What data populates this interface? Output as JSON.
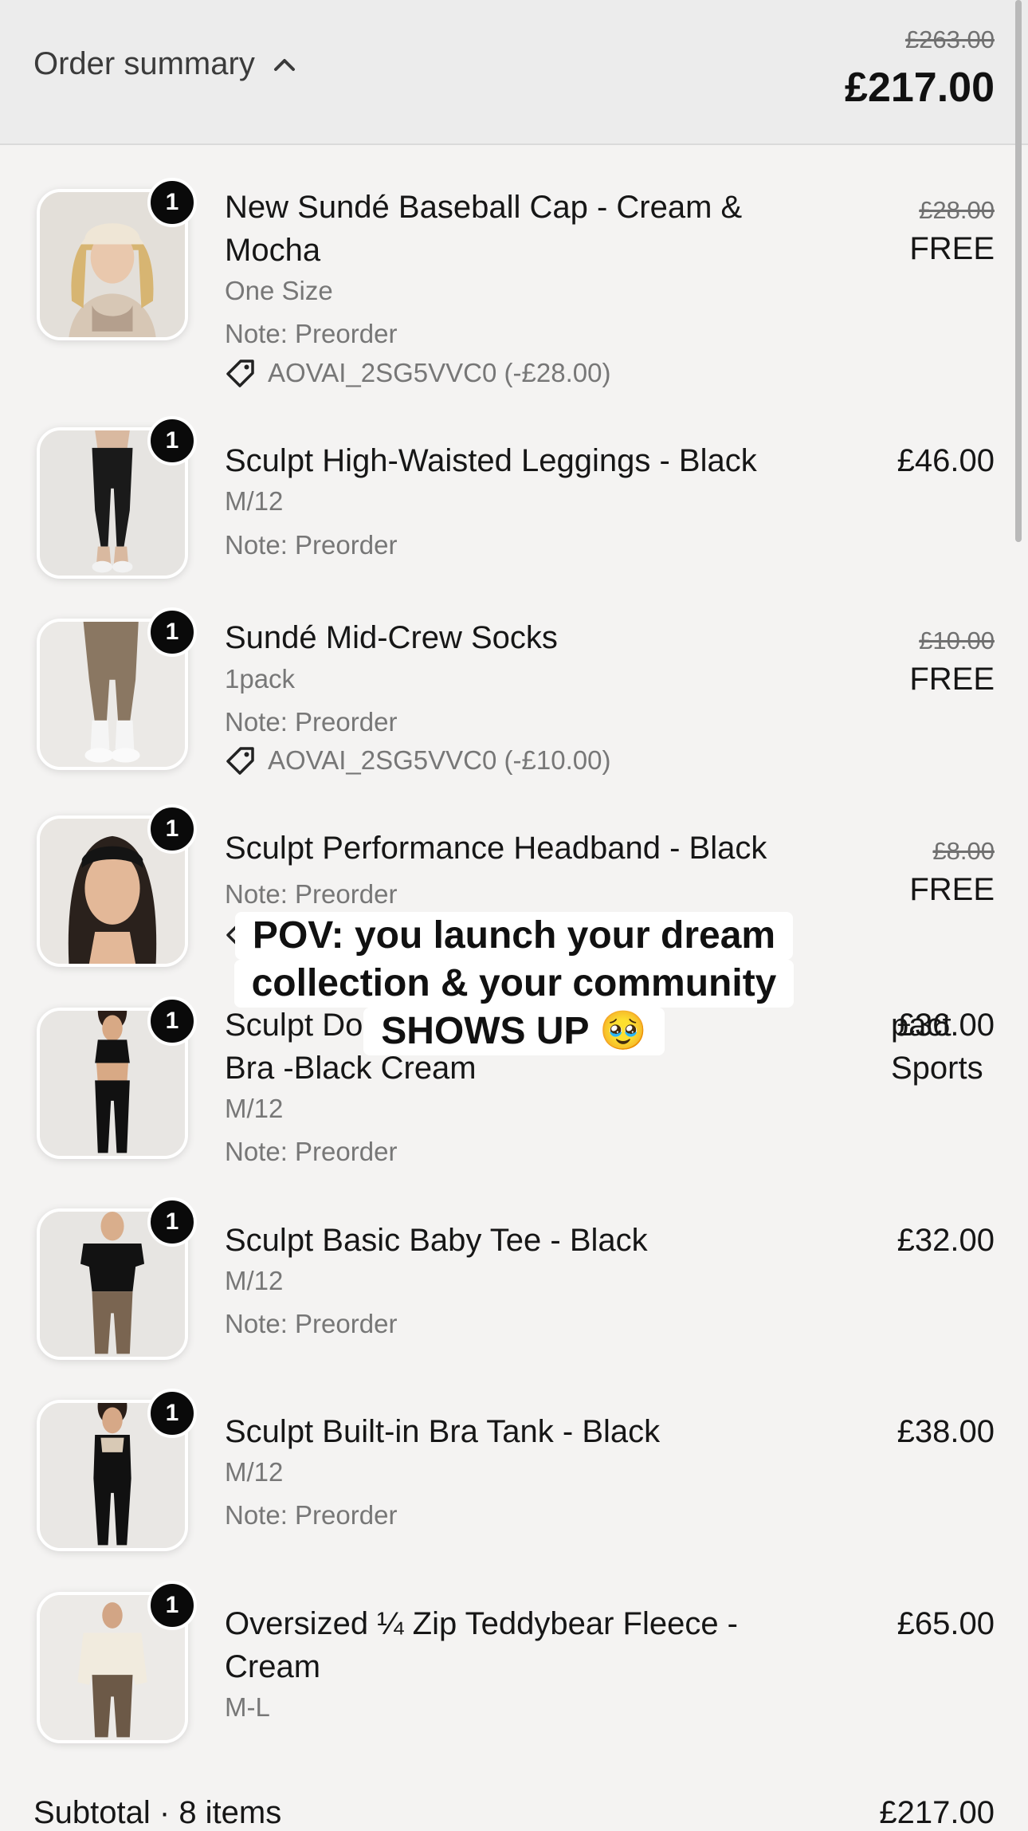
{
  "header": {
    "title": "Order summary",
    "toggle_icon": "chevron-up-icon",
    "original_total": "£263.00",
    "total": "£217.00"
  },
  "items": [
    {
      "name": "New Sundé Baseball Cap - Cream & Mocha",
      "qty": "1",
      "variant": "One Size",
      "note": "Note: Preorder",
      "discount": "AOVAI_2SG5VVC0 (-£28.00)",
      "price_old": "£28.00",
      "price": "FREE"
    },
    {
      "name": "Sculpt High-Waisted Leggings - Black",
      "qty": "1",
      "variant": "M/12",
      "note": "Note: Preorder",
      "price": "£46.00"
    },
    {
      "name": "Sundé Mid-Crew Socks",
      "qty": "1",
      "variant": "1pack",
      "note": "Note: Preorder",
      "discount": "AOVAI_2SG5VVC0 (-£10.00)",
      "price_old": "£10.00",
      "price": "FREE"
    },
    {
      "name": "Sculpt Performance Headband - Black",
      "qty": "1",
      "note": "Note: Preorder",
      "price_old": "£8.00",
      "price": "FREE"
    },
    {
      "name": "Sculpt Do",
      "name_tail": "pact Sports",
      "name_line2": "Bra -Black Cream",
      "qty": "1",
      "variant": "M/12",
      "note": "Note: Preorder",
      "price": "£36.00"
    },
    {
      "name": "Sculpt Basic Baby Tee - Black",
      "qty": "1",
      "variant": "M/12",
      "note": "Note: Preorder",
      "price": "£32.00"
    },
    {
      "name": "Sculpt Built-in Bra Tank - Black",
      "qty": "1",
      "variant": "M/12",
      "note": "Note: Preorder",
      "price": "£38.00"
    },
    {
      "name": "Oversized ¼ Zip Teddybear Fleece - Cream",
      "qty": "1",
      "variant": "M-L",
      "price": "£65.00"
    }
  ],
  "caption": {
    "line1": "POV: you launch your dream",
    "line2": "collection & your community",
    "line3": "SHOWS UP 🥹"
  },
  "footer": {
    "subtotal_label": "Subtotal · 8 items",
    "subtotal_value": "£217.00"
  },
  "colors": {
    "background": "#f4f3f2",
    "header_background": "#ececec",
    "badge": "#0a0a0a",
    "muted_text": "#777777"
  }
}
